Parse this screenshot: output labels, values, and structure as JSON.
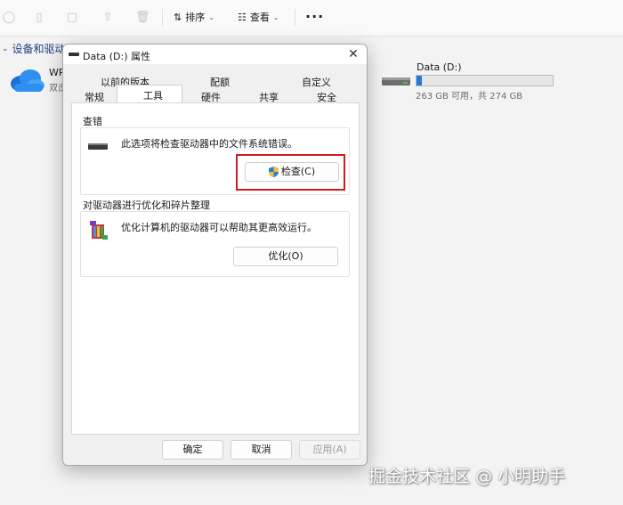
{
  "toolbar": {
    "sort_label": "排序",
    "view_label": "查看",
    "more_label": "···"
  },
  "explorer": {
    "section_title": "设备和驱动器",
    "wp_name": "WP",
    "wp_sub": "双击",
    "drive_name": "Data (D:)",
    "drive_free": "263 GB 可用，共 274 GB",
    "drive_used_fraction": 0.04
  },
  "dialog": {
    "title": "Data (D:) 属性",
    "tabs_back": [
      "以前的版本",
      "配额",
      "自定义"
    ],
    "tabs_front": [
      "常规",
      "工具",
      "硬件",
      "共享",
      "安全"
    ],
    "active_tab": "工具",
    "error_check": {
      "group_label": "查错",
      "description": "此选项将检查驱动器中的文件系统错误。",
      "button_label": "检查(C)"
    },
    "optimize": {
      "group_label": "对驱动器进行优化和碎片整理",
      "description": "优化计算机的驱动器可以帮助其更高效运行。",
      "button_label": "优化(O)"
    },
    "footer": {
      "ok_label": "确定",
      "cancel_label": "取消",
      "apply_label": "应用(A)"
    }
  },
  "watermark": "掘金技术社区 @ 小明助手",
  "colors": {
    "highlight": "#d01c1c",
    "accent": "#2a78d6"
  }
}
